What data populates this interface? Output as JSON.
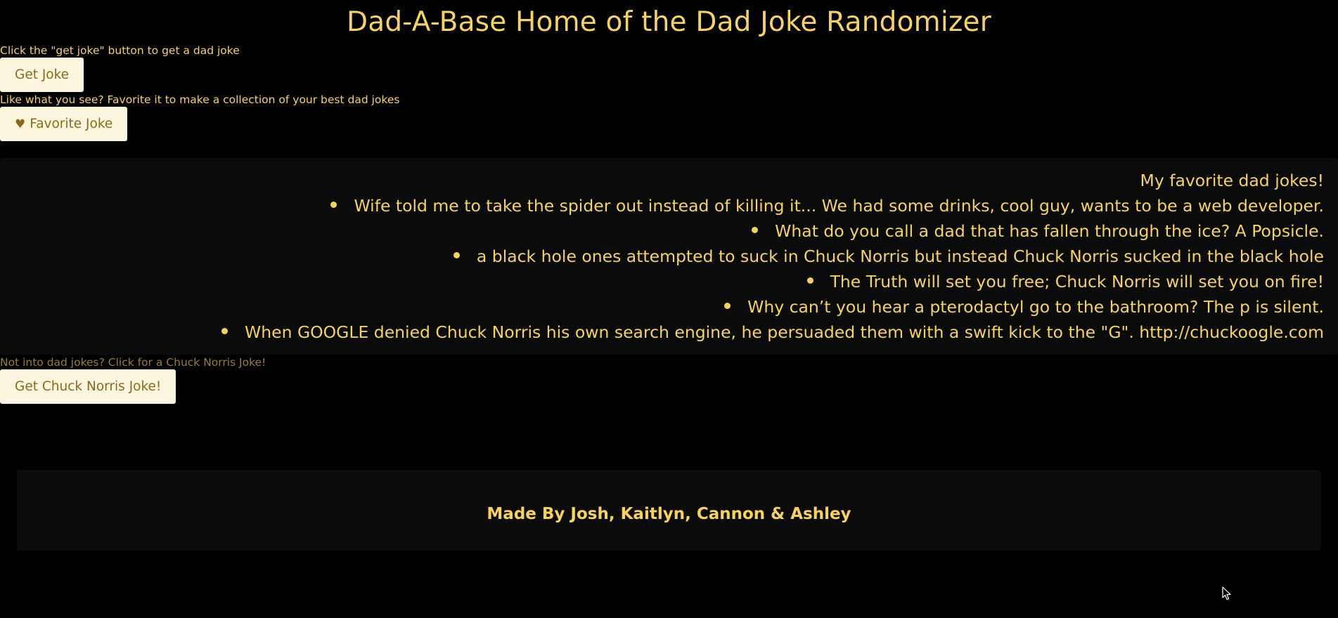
{
  "header": {
    "title": "Dad-A-Base Home of the Dad Joke Randomizer"
  },
  "dad_joke": {
    "instruction": "Click the \"get joke\" button to get a dad joke",
    "button_label": "Get Joke"
  },
  "favorite": {
    "instruction": "Like what you see? Favorite it to make a collection of your best dad jokes",
    "button_icon": "heart-icon",
    "button_label": "Favorite Joke"
  },
  "favorites": {
    "title": "My favorite dad jokes!",
    "items": [
      "Wife told me to take the spider out instead of killing it... We had some drinks, cool guy, wants to be a web developer.",
      "What do you call a dad that has fallen through the ice? A Popsicle.",
      "a black hole ones attempted to suck in Chuck Norris but instead Chuck Norris sucked in the black hole",
      "The Truth will set you free; Chuck Norris will set you on fire!",
      "Why can’t you hear a pterodactyl go to the bathroom? The p is silent.",
      "When GOOGLE denied Chuck Norris his own search engine, he persuaded them with a swift kick to the \"G\". http://chuckoogle.com"
    ]
  },
  "chuck_norris": {
    "instruction": "Not into dad jokes? Click for a Chuck Norris Joke!",
    "button_label": "Get Chuck Norris Joke!"
  },
  "footer": {
    "credits": "Made By Josh, Kaitlyn, Cannon & Ashley"
  },
  "colors": {
    "background": "#000000",
    "text_gold": "#f7d35c",
    "text_dim_gold": "#9a7e2e",
    "button_bg": "#fdf6df",
    "button_text": "#8a6a1a",
    "panel_bg": "#0b0b0b"
  }
}
